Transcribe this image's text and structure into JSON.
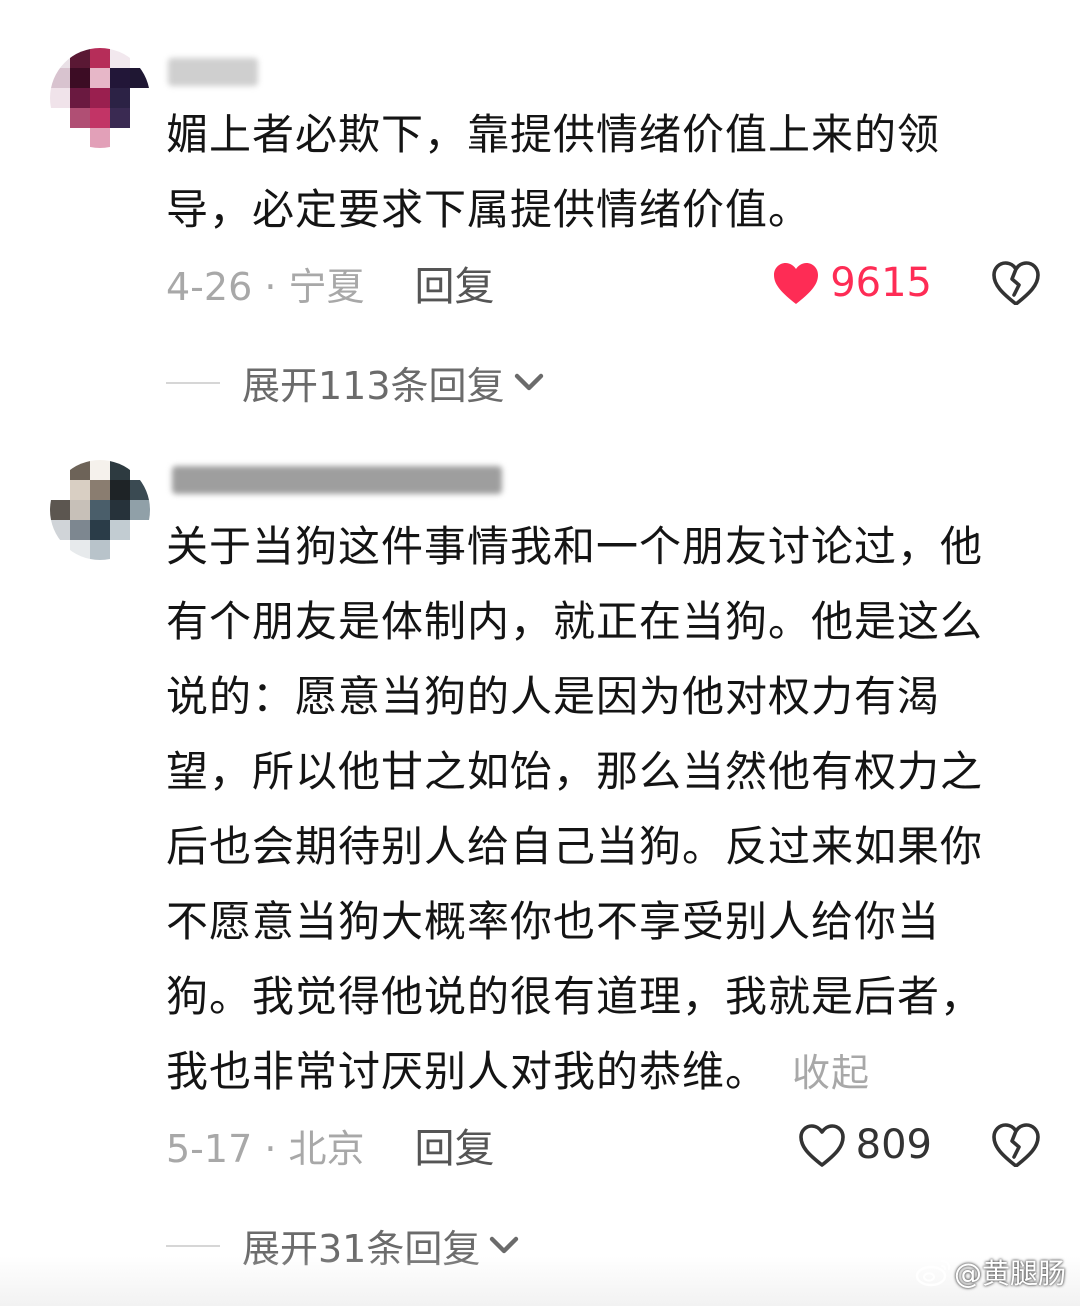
{
  "comments": [
    {
      "text_lines": [
        "媚上者必欺下，靠提供情绪价值上来的领",
        "导，必定要求下属提供情绪价值。"
      ],
      "date": "4-26 · 宁夏",
      "reply_label": "回复",
      "likes": "9615",
      "liked": true,
      "expand_label": "展开113条回复"
    },
    {
      "text_lines": [
        "关于当狗这件事情我和一个朋友讨论过，他",
        "有个朋友是体制内，就正在当狗。他是这么",
        "说的：愿意当狗的人是因为他对权力有渴",
        "望，所以他甘之如饴，那么当然他有权力之",
        "后也会期待别人给自己当狗。反过来如果你",
        "不愿意当狗大概率你也不享受别人给你当",
        "狗。我觉得他说的很有道理，我就是后者，",
        "我也非常讨厌别人对我的恭维。"
      ],
      "collapse_label": "收起",
      "date": "5-17 · 北京",
      "reply_label": "回复",
      "likes": "809",
      "liked": false,
      "expand_label": "展开31条回复"
    }
  ],
  "watermark": "@黄腿肠",
  "icons": {
    "like_filled": "heart-filled-icon",
    "like_outline": "heart-outline-icon",
    "dislike": "broken-heart-icon",
    "expand": "chevron-down-icon",
    "watermark_logo": "weibo-logo-icon"
  },
  "colors": {
    "like_active": "#fe2c55",
    "text_primary": "#141414",
    "text_secondary": "#a8a8a8"
  }
}
